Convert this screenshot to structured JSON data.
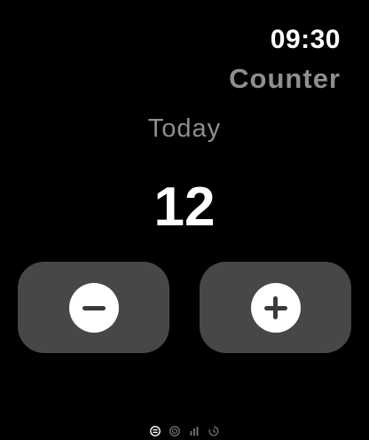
{
  "status": {
    "time": "09:30"
  },
  "app": {
    "title": "Counter"
  },
  "counter": {
    "label": "Today",
    "value": "12",
    "decrement_icon": "minus-icon",
    "increment_icon": "plus-icon"
  },
  "pagination": {
    "pages": [
      {
        "icon": "counter-page-icon",
        "active": true
      },
      {
        "icon": "target-page-icon",
        "active": false
      },
      {
        "icon": "stats-page-icon",
        "active": false
      },
      {
        "icon": "history-page-icon",
        "active": false
      }
    ]
  },
  "colors": {
    "background": "#000000",
    "button": "#47474a",
    "secondary_text": "#8e8e93",
    "primary_text": "#ffffff"
  }
}
